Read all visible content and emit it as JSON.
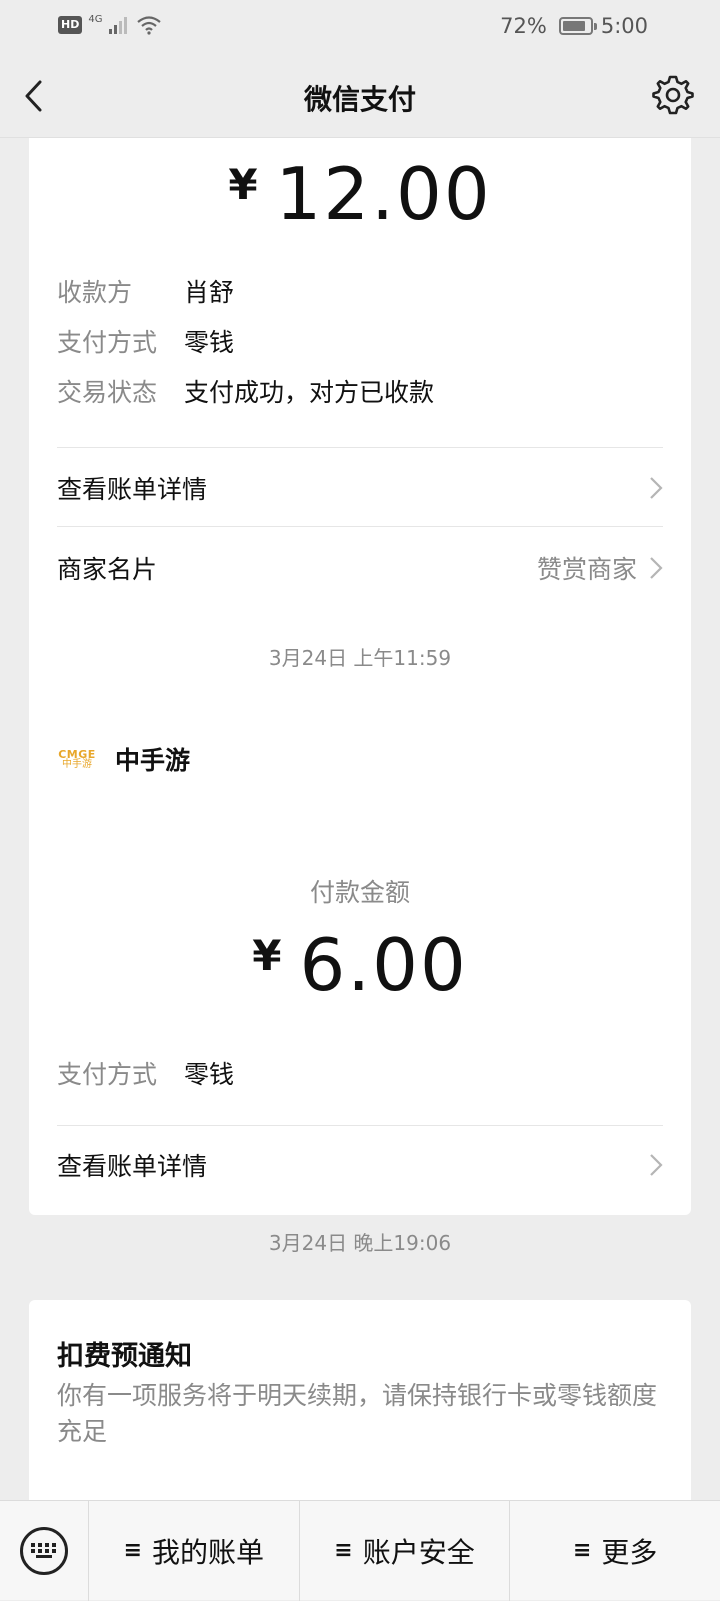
{
  "status_bar": {
    "hd": "HD",
    "network": "4G",
    "battery_percent": "72%",
    "battery_level": 0.72,
    "time": "5:00"
  },
  "nav": {
    "title": "微信支付"
  },
  "card1": {
    "currency": "¥",
    "amount": "12.00",
    "rows": [
      {
        "key": "收款方",
        "value": "肖舒"
      },
      {
        "key": "支付方式",
        "value": "零钱"
      },
      {
        "key": "交易状态",
        "value": "支付成功，对方已收款"
      }
    ],
    "bill_detail": "查看账单详情",
    "merchant_card": "商家名片",
    "merchant_card_action": "赞赏商家"
  },
  "timestamp1": "3月24日 上午11:59",
  "card2": {
    "logo_top": "CMGE",
    "logo_bottom": "中手游",
    "merchant_name": "中手游",
    "pay_label": "付款金额",
    "currency": "¥",
    "amount": "6.00",
    "rows": [
      {
        "key": "支付方式",
        "value": "零钱"
      }
    ],
    "bill_detail": "查看账单详情"
  },
  "timestamp2": "3月24日 晚上19:06",
  "card3": {
    "title": "扣费预通知",
    "body": "你有一项服务将于明天续期，请保持银行卡或零钱额度充足"
  },
  "bottom_menu": {
    "hamburger": "≡",
    "items": [
      "我的账单",
      "账户安全",
      "更多"
    ]
  }
}
